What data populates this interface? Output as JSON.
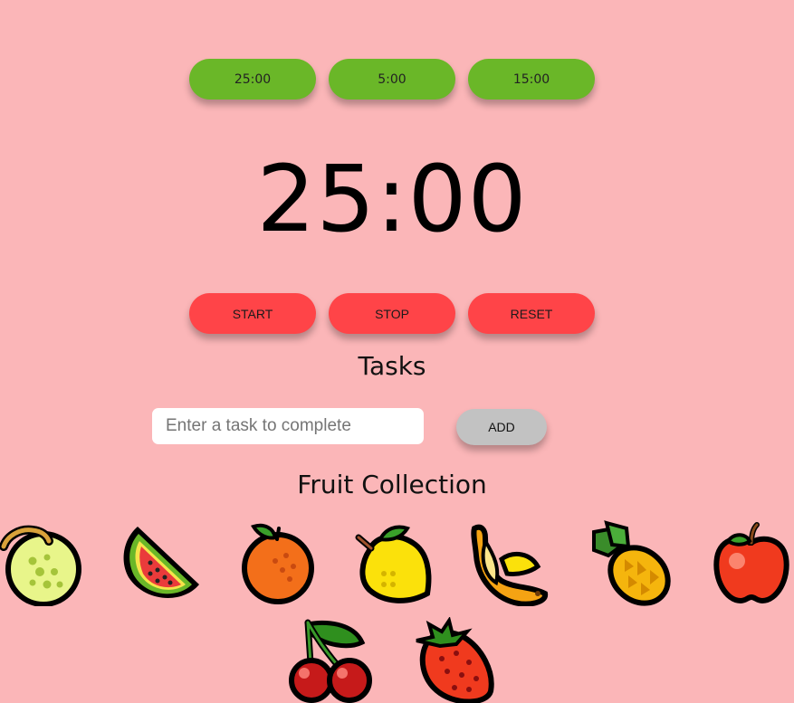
{
  "presets": [
    {
      "label": "25:00"
    },
    {
      "label": "5:00"
    },
    {
      "label": "15:00"
    }
  ],
  "timer": {
    "display": "25:00"
  },
  "controls": {
    "start_label": "START",
    "stop_label": "STOP",
    "reset_label": "RESET"
  },
  "tasks": {
    "title": "Tasks",
    "placeholder": "Enter a task to complete",
    "value": "",
    "add_label": "ADD"
  },
  "fruits": {
    "title": "Fruit Collection",
    "items": [
      "melon",
      "watermelon",
      "orange",
      "lemon",
      "banana",
      "pineapple",
      "apple",
      "cherries",
      "strawberry"
    ]
  },
  "colors": {
    "background": "#fbb6b8",
    "preset_button": "#6ab728",
    "control_button": "#ff4448",
    "add_button": "#c2c2c2"
  }
}
